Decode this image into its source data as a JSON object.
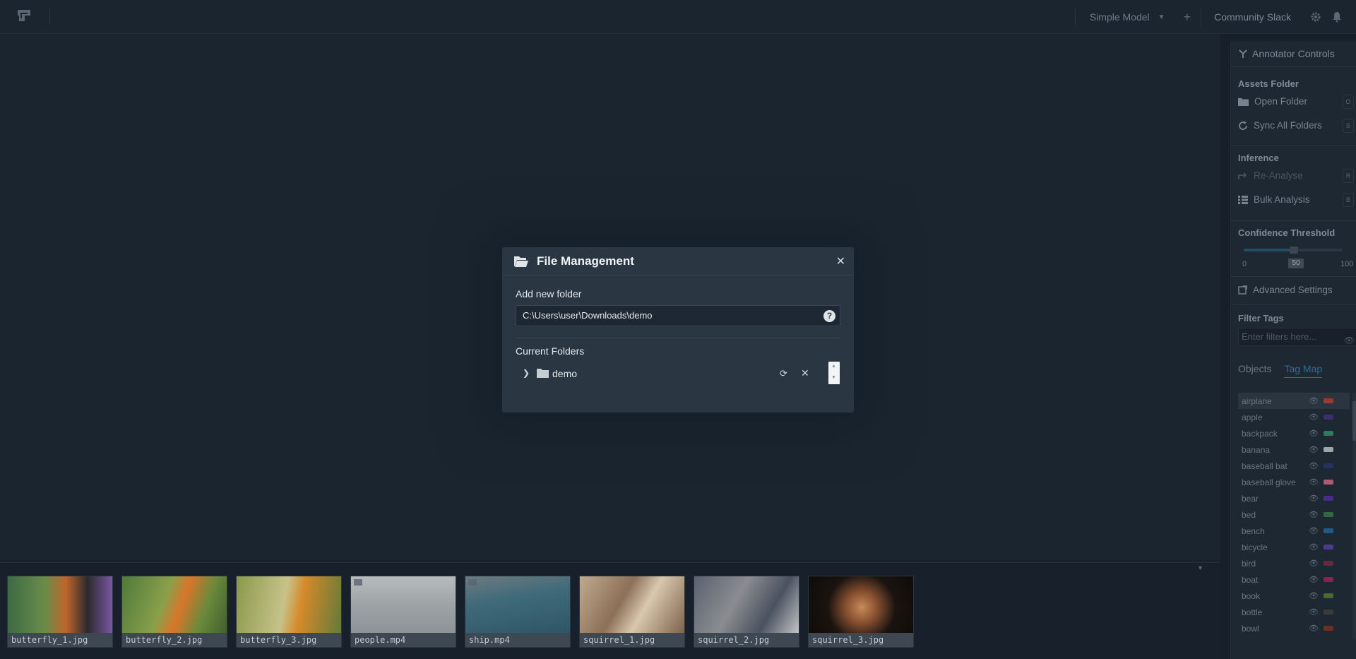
{
  "topbar": {
    "model_label": "Simple Model",
    "community_label": "Community Slack"
  },
  "dialog": {
    "title": "File Management",
    "add_folder_label": "Add new folder",
    "folder_path_value": "C:\\Users\\user\\Downloads\\demo",
    "current_folders_label": "Current Folders",
    "folders": [
      {
        "name": "demo"
      }
    ]
  },
  "sidebar": {
    "title": "Annotator Controls",
    "assets_heading": "Assets Folder",
    "open_folder": "Open Folder",
    "open_folder_key": "O",
    "sync_folders": "Sync All Folders",
    "sync_folders_key": "S",
    "inference_heading": "Inference",
    "reanalyse": "Re-Analyse",
    "reanalyse_key": "R",
    "bulk_analysis": "Bulk Analysis",
    "bulk_analysis_key": "B",
    "confidence_heading": "Confidence Threshold",
    "confidence_min": "0",
    "confidence_value": "50",
    "confidence_max": "100",
    "advanced_settings": "Advanced Settings",
    "filter_heading": "Filter Tags",
    "filter_placeholder": "Enter filters here...",
    "tab_objects": "Objects",
    "tab_tagmap": "Tag Map",
    "tags": [
      {
        "name": "airplane",
        "color": "#9a3b2e"
      },
      {
        "name": "apple",
        "color": "#3b2f6e"
      },
      {
        "name": "backpack",
        "color": "#2e7b62"
      },
      {
        "name": "banana",
        "color": "#9fa4a8"
      },
      {
        "name": "baseball bat",
        "color": "#27305e"
      },
      {
        "name": "baseball glove",
        "color": "#b05a72"
      },
      {
        "name": "bear",
        "color": "#4a2a8a"
      },
      {
        "name": "bed",
        "color": "#2f6b3b"
      },
      {
        "name": "bench",
        "color": "#1f5a8a"
      },
      {
        "name": "bicycle",
        "color": "#4a3c8a"
      },
      {
        "name": "bird",
        "color": "#6e2440"
      },
      {
        "name": "boat",
        "color": "#8a2250"
      },
      {
        "name": "book",
        "color": "#4c6a2a"
      },
      {
        "name": "bottle",
        "color": "#3a3a3a"
      },
      {
        "name": "bowl",
        "color": "#6e3020"
      }
    ]
  },
  "thumbnails": [
    {
      "label": "butterfly_1.jpg",
      "video": false,
      "bg": "linear-gradient(90deg,#3c6a43 0%,#6a8c4a 35%,#c0652a 55%,#2c2a2e 75%,#7c5aa8 100%)"
    },
    {
      "label": "butterfly_2.jpg",
      "video": false,
      "bg": "linear-gradient(110deg,#4e7a3a 0%,#8aa04a 40%,#d9762a 55%,#6b8a3b 75%,#3e5e2e 100%)"
    },
    {
      "label": "butterfly_3.jpg",
      "video": false,
      "bg": "linear-gradient(100deg,#8a9a4a 0%,#c7c28a 45%,#d68a2a 60%,#5e7a3a 100%)"
    },
    {
      "label": "people.mp4",
      "video": true,
      "bg": "linear-gradient(180deg,#b8bcbe 0%,#9ea3a6 50%,#8d9396 100%)"
    },
    {
      "label": "ship.mp4",
      "video": true,
      "bg": "linear-gradient(170deg,#6d7b80 0%,#3f6a7a 40%,#2f5566 100%)"
    },
    {
      "label": "squirrel_1.jpg",
      "video": false,
      "bg": "linear-gradient(120deg,#c0aa8e 0%,#8c7058 40%,#d9c7ae 60%,#7a6048 100%)"
    },
    {
      "label": "squirrel_2.jpg",
      "video": false,
      "bg": "linear-gradient(120deg,#5a6270 0%,#8a8c90 40%,#4a5260 70%,#c6c8ca 100%)"
    },
    {
      "label": "squirrel_3.jpg",
      "video": false,
      "bg": "radial-gradient(circle at 50% 55%,#c88a5a 0%,#8a5030 25%,#1a1410 55%,#0e0b09 100%)"
    }
  ]
}
